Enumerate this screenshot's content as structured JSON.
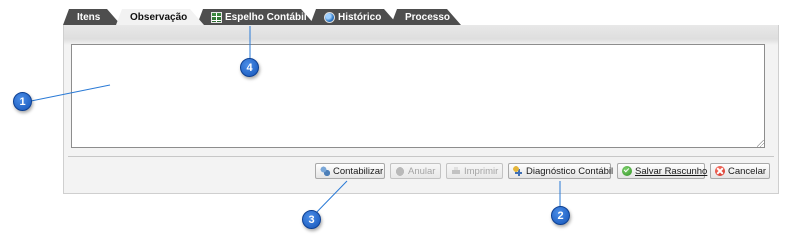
{
  "tabs": [
    {
      "label": "Itens",
      "icon": null
    },
    {
      "label": "Observação",
      "icon": null,
      "active": true
    },
    {
      "label": "Espelho Contábil",
      "icon": "grid-table-icon"
    },
    {
      "label": "Histórico",
      "icon": "globe-icon"
    },
    {
      "label": "Processo",
      "icon": null
    }
  ],
  "observation": {
    "value": ""
  },
  "buttons": {
    "contabilizar": {
      "label": "Contabilizar",
      "icon": "gears-icon"
    },
    "anular": {
      "label": "Anular",
      "icon": "hand-icon",
      "disabled": true
    },
    "imprimir": {
      "label": "Imprimir",
      "icon": "printer-icon",
      "disabled": true
    },
    "diagnostico": {
      "label": "Diagnóstico Contábil",
      "icon": "diagnostic-icon"
    },
    "salvar": {
      "label": "Salvar Rascunho",
      "icon": "check-icon"
    },
    "cancelar": {
      "label": "Cancelar",
      "icon": "cancel-icon"
    }
  },
  "callouts": {
    "c1": "1",
    "c2": "2",
    "c3": "3",
    "c4": "4"
  },
  "colors": {
    "tab_inactive": "#4e4e4e",
    "tab_active": "#f2f2f2",
    "callout": "#1f66d1"
  }
}
